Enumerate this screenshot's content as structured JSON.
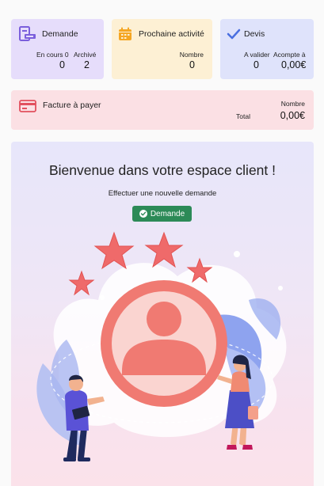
{
  "cards": {
    "demande": {
      "title": "Demande",
      "icon": "clipboard-form-icon",
      "accent": "#7b5fdc",
      "items": [
        {
          "label": "En cours 0",
          "value": "0"
        },
        {
          "label": "Archivé",
          "value": "2"
        }
      ]
    },
    "activite": {
      "title": "Prochaine activité",
      "icon": "calendar-icon",
      "accent": "#f5a623",
      "label": "Nombre",
      "value": "0"
    },
    "devis": {
      "title": "Devis",
      "icon": "checkmark-icon",
      "accent": "#4a6fe0",
      "items": [
        {
          "label": "A valider",
          "value": "0"
        },
        {
          "label": "Acompte à",
          "value": "0,00€"
        }
      ]
    },
    "facture": {
      "title": "Facture à payer",
      "icon": "credit-card-icon",
      "accent": "#e2505e",
      "label": "Nombre",
      "total_label": "Total",
      "value": "0,00€"
    }
  },
  "welcome": {
    "title": "Bienvenue dans votre espace client !",
    "subtitle": "Effectuer une nouvelle demande",
    "button_label": "Demande",
    "button_color": "#2c8a57"
  }
}
